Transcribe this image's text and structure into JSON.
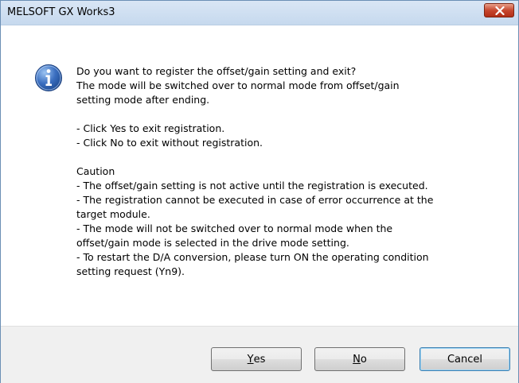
{
  "window": {
    "title": "MELSOFT GX Works3",
    "close_icon": "close-icon"
  },
  "icon": {
    "name": "information-icon",
    "color": "#3b6fc0"
  },
  "message": {
    "question": [
      "Do you want to register the offset/gain setting and exit?",
      "The mode will be switched over to normal mode from offset/gain",
      "setting mode after ending."
    ],
    "options": [
      "- Click Yes to exit registration.",
      "- Click No to exit without registration."
    ],
    "caution_title": "Caution",
    "caution": [
      "- The offset/gain setting is not active until the registration is executed.",
      "- The registration cannot be executed in case of error occurrence at the",
      "target module.",
      "- The mode will not be switched over to normal mode when the",
      "offset/gain mode is selected in the drive mode setting.",
      "- To restart the D/A conversion, please turn ON the operating condition",
      "setting request (Yn9)."
    ]
  },
  "buttons": {
    "yes": {
      "accel": "Y",
      "rest": "es"
    },
    "no": {
      "accel": "N",
      "rest": "o"
    },
    "cancel": {
      "label": "Cancel"
    }
  }
}
